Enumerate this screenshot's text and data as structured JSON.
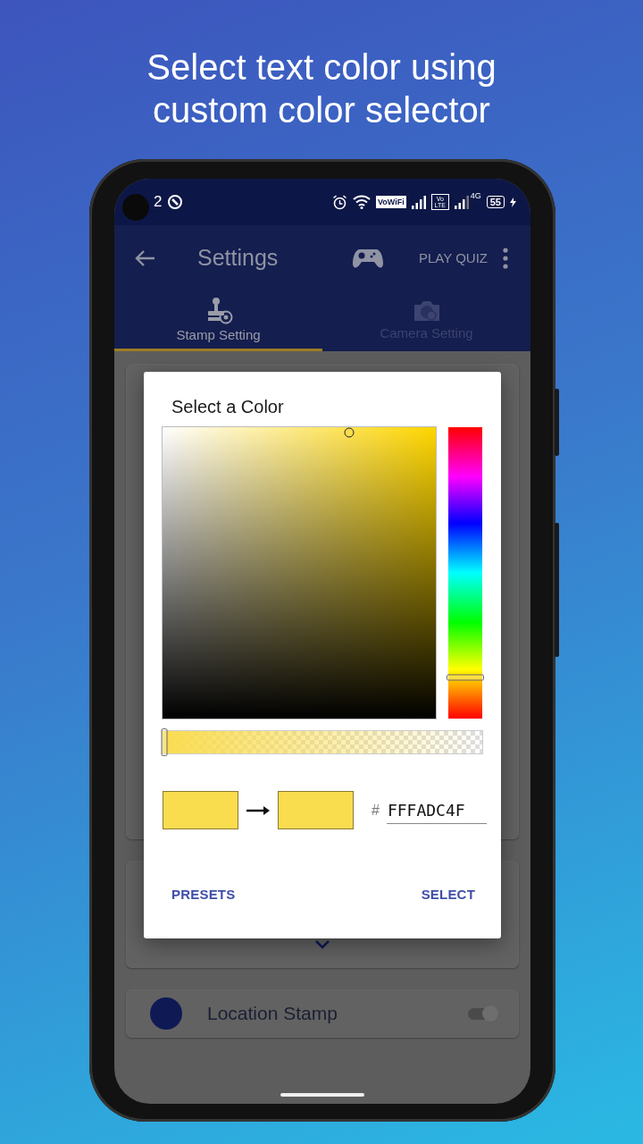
{
  "headline": "Select text color using custom color selector",
  "status_bar": {
    "time": "2",
    "wifi_badge": "VoWiFi",
    "lte_badge": "Vo LTE",
    "network": "4G",
    "battery": "55"
  },
  "app_bar": {
    "title": "Settings",
    "action": "PLAY QUIZ"
  },
  "tabs": [
    {
      "label": "Stamp Setting",
      "selected": true
    },
    {
      "label": "Camera Setting",
      "selected": false
    }
  ],
  "background_cards": [
    {
      "kind": "blank"
    },
    {
      "kind": "expander"
    },
    {
      "kind": "toggle",
      "label": "Location Stamp",
      "on": true
    }
  ],
  "dialog": {
    "title": "Select a Color",
    "picker": {
      "color": "#fadc4f"
    },
    "hue_slider": {
      "level": 0.14
    },
    "alpha_slider": {
      "level": 0
    },
    "swatches": [
      {
        "color": "#fadc4f"
      },
      {
        "color": "#fadc4f"
      }
    ],
    "hex_field": {
      "prefix": "#",
      "value": "FFFADC4F"
    },
    "buttons": [
      "PRESETS",
      "SELECT"
    ]
  }
}
